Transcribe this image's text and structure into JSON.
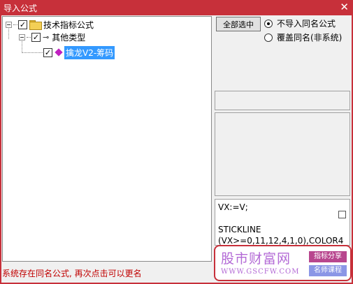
{
  "window": {
    "title": "导入公式",
    "close_glyph": "✕"
  },
  "tree": {
    "root": {
      "label": "技术指标公式",
      "checked": true,
      "expanded": true,
      "icon": "folder-icon"
    },
    "child": {
      "label": "其他类型",
      "checked": true,
      "expanded": true,
      "icon": "key-icon",
      "icon_glyph": "⊸"
    },
    "leaf": {
      "label": "擒龙V2-筹码",
      "checked": true,
      "selected": true,
      "icon": "formula-icon",
      "icon_color": "#c020c0"
    },
    "check_glyph": "✓"
  },
  "actions": {
    "select_all_label": "全部选中",
    "options": [
      {
        "label": "不导入同名公式",
        "selected": true
      },
      {
        "label": "覆盖同名(非系统)",
        "selected": false
      }
    ]
  },
  "formula_preview": {
    "lines": [
      "VX:=V;",
      "",
      "STICKLINE",
      "(VX>=0,11,12,4,1,0),COLOR4"
    ]
  },
  "status": {
    "message": "系统存在同名公式, 再次点击可以更名",
    "color": "#c00000"
  },
  "watermark": {
    "site_name": "股市财富网",
    "url": "WWW.GSCFW.COM",
    "tag1": "指标分享",
    "tag2": "名师课程"
  },
  "colors": {
    "title_bar": "#c7303a",
    "selection": "#3399ff"
  }
}
